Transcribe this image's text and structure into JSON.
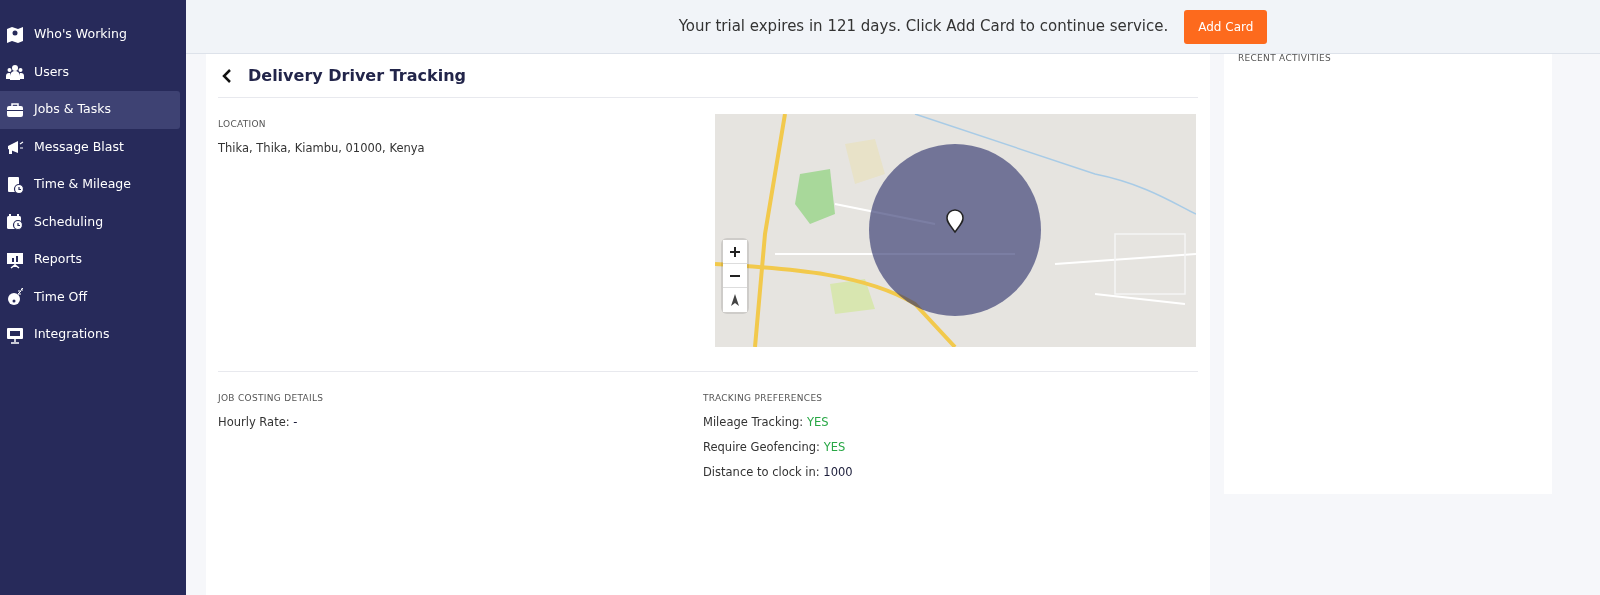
{
  "sidebar": {
    "items": [
      {
        "label": "Who's Working",
        "selected": false
      },
      {
        "label": "Users",
        "selected": false
      },
      {
        "label": "Jobs & Tasks",
        "selected": true
      },
      {
        "label": "Message Blast",
        "selected": false
      },
      {
        "label": "Time & Mileage",
        "selected": false
      },
      {
        "label": "Scheduling",
        "selected": false
      },
      {
        "label": "Reports",
        "selected": false
      },
      {
        "label": "Time Off",
        "selected": false
      },
      {
        "label": "Integrations",
        "selected": false
      }
    ]
  },
  "trial_banner": {
    "message": "Your trial expires in 121 days. Click Add Card to continue service.",
    "button": "Add Card"
  },
  "job": {
    "title": "Delivery Driver Tracking",
    "location": {
      "heading": "LOCATION",
      "address": "Thika, Thika, Kiambu, 01000, Kenya"
    },
    "job_costing": {
      "heading": "JOB COSTING DETAILS",
      "rows": [
        {
          "label": "Hourly Rate:",
          "value": "-",
          "kind": "plain"
        }
      ]
    },
    "tracking": {
      "heading": "TRACKING PREFERENCES",
      "rows": [
        {
          "label": "Mileage Tracking:",
          "value": "YES",
          "kind": "flag"
        },
        {
          "label": "Require Geofencing:",
          "value": "YES",
          "kind": "flag"
        },
        {
          "label": "Distance to clock in:",
          "value": "1000",
          "kind": "plain"
        }
      ]
    }
  },
  "recent_activities": {
    "heading": "RECENT ACTIVITIES"
  }
}
